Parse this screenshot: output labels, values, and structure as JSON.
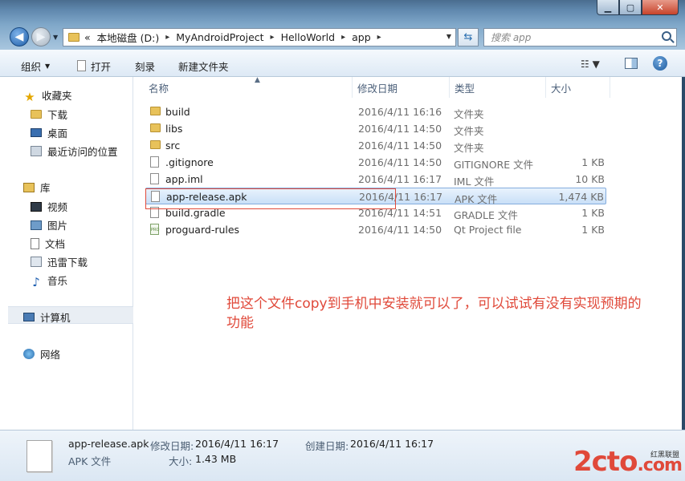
{
  "address": {
    "crumbs": [
      "本地磁盘 (D:)",
      "MyAndroidProject",
      "HelloWorld",
      "app"
    ],
    "prefix": "«",
    "search_placeholder": "搜索 app"
  },
  "toolbar": {
    "organize": "组织",
    "open": "打开",
    "burn": "刻录",
    "new_folder": "新建文件夹"
  },
  "nav": {
    "favorites": "收藏夹",
    "downloads": "下载",
    "desktop": "桌面",
    "recent": "最近访问的位置",
    "libraries": "库",
    "videos": "视频",
    "pictures": "图片",
    "documents": "文档",
    "thunder": "迅雷下载",
    "music": "音乐",
    "computer": "计算机",
    "network": "网络"
  },
  "columns": {
    "name": "名称",
    "date": "修改日期",
    "type": "类型",
    "size": "大小"
  },
  "files": [
    {
      "name": "build",
      "date": "2016/4/11 16:16",
      "type": "文件夹",
      "size": "",
      "icon": "folder-icon"
    },
    {
      "name": "libs",
      "date": "2016/4/11 14:50",
      "type": "文件夹",
      "size": "",
      "icon": "folder-icon"
    },
    {
      "name": "src",
      "date": "2016/4/11 14:50",
      "type": "文件夹",
      "size": "",
      "icon": "folder-icon"
    },
    {
      "name": ".gitignore",
      "date": "2016/4/11 14:50",
      "type": "GITIGNORE 文件",
      "size": "1 KB",
      "icon": "file-icon"
    },
    {
      "name": "app.iml",
      "date": "2016/4/11 16:17",
      "type": "IML 文件",
      "size": "10 KB",
      "icon": "file-icon"
    },
    {
      "name": "app-release.apk",
      "date": "2016/4/11 16:17",
      "type": "APK 文件",
      "size": "1,474 KB",
      "icon": "file-icon"
    },
    {
      "name": "build.gradle",
      "date": "2016/4/11 14:51",
      "type": "GRADLE 文件",
      "size": "1 KB",
      "icon": "file-icon"
    },
    {
      "name": "proguard-rules",
      "date": "2016/4/11 14:50",
      "type": "Qt Project file",
      "size": "1 KB",
      "icon": "qt-project-file-icon"
    }
  ],
  "annotation": {
    "line1": "把这个文件copy到手机中安装就可以了，可以试试有没有实现预期的",
    "line2": "功能"
  },
  "details": {
    "filename": "app-release.apk",
    "filetype": "APK 文件",
    "modified_label": "修改日期:",
    "modified_value": "2016/4/11 16:17",
    "created_label": "创建日期:",
    "created_value": "2016/4/11 16:17",
    "size_label": "大小:",
    "size_value": "1.43 MB"
  },
  "watermark": {
    "text": "2cto",
    "suffix": ".com",
    "small": "红黑联盟"
  },
  "colors": {
    "annotation_red": "#e0493a",
    "selection_blue": "#c9e0f7"
  }
}
